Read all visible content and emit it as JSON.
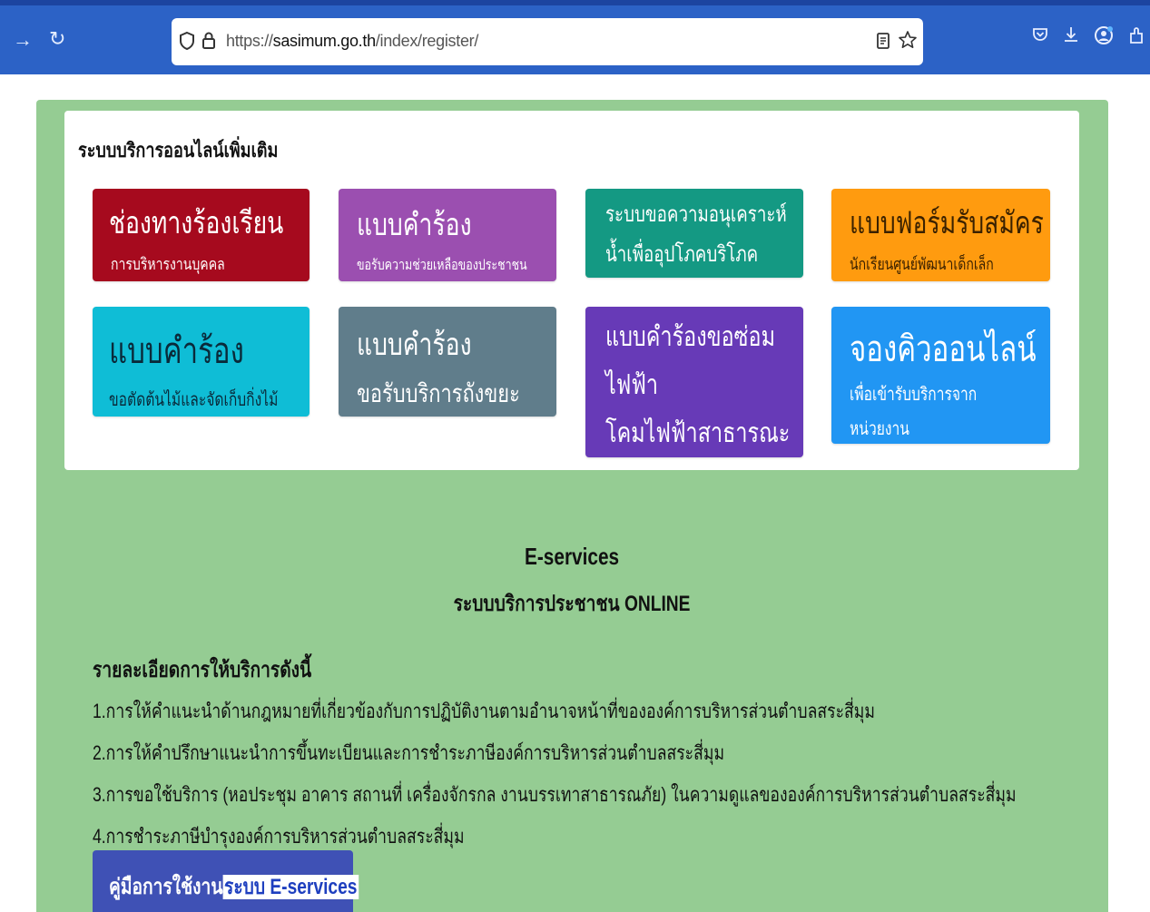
{
  "browser": {
    "url_prefix": "https://",
    "url_host": "sasimum.go.th",
    "url_path": "/index/register/",
    "icons": [
      "forward-icon",
      "reload-icon",
      "shield-icon",
      "lock-icon",
      "reader-mode-icon",
      "star-icon",
      "pocket-icon",
      "download-icon",
      "account-icon",
      "extensions-icon"
    ]
  },
  "card": {
    "title": "ระบบบริการออนไลน์เพิ่มเติม",
    "tiles": [
      {
        "main": "ช่องทางร้องเรียน",
        "sub": "การบริหารงานบุคคล",
        "color": "#a60a1e"
      },
      {
        "main": "แบบคำร้อง",
        "sub": "ขอรับความช่วยเหลือของประชาชน",
        "color": "#9b4fb0"
      },
      {
        "line1": "ระบบขอความอนุเคราะห์",
        "line2": "น้ำเพื่ออุปโภคบริโภค",
        "color": "#149983"
      },
      {
        "main": "แบบฟอร์มรับสมัคร",
        "sub": "นักเรียนศูนย์พัฒนาเด็กเล็ก",
        "color": "#ff9b0f"
      },
      {
        "main": "แบบคำร้อง",
        "sub": "ขอตัดต้นไม้และจัดเก็บกิ่งไม้",
        "color": "#0fbdd6"
      },
      {
        "line1": "แบบคำร้อง",
        "line2": "ขอรับบริการถังขยะ",
        "color": "#607d8b"
      },
      {
        "line1": "แบบคำร้องขอซ่อม",
        "line2": "ไฟฟ้า",
        "line3": "โคมไฟฟ้าสาธารณะ",
        "color": "#673ab7"
      },
      {
        "main": "จองคิวออนไลน์",
        "line1": "เพื่อเข้ารับบริการจาก",
        "line2": "หน่วยงาน",
        "color": "#2196f3"
      }
    ]
  },
  "eservices": {
    "title": "E-services",
    "subtitle": "ระบบบริการประชาชน ONLINE",
    "section_heading": "รายละเอียดการให้บริการดังนี้",
    "items": [
      "1.การให้คำแนะนำด้านกฎหมายที่เกี่ยวข้องกับการปฏิบัติงานตามอำนาจหน้าที่ขององค์การบริหารส่วนตำบลสระสี่มุม",
      "2.การให้คำปรึกษาแนะนำการขึ้นทะเบียนและการชำระภาษีองค์การบริหารส่วนตำบลสระสี่มุม",
      "3.การขอใช้บริการ (หอประชุม อาคาร สถานที่ เครื่องจักรกล งานบรรเทาสาธารณภัย) ในความดูแลขององค์การบริหารส่วนตำบลสระสี่มุม",
      "4.การชำระภาษีบำรุงองค์การบริหารส่วนตำบลสระสี่มุม"
    ],
    "guide_prefix": "คู่มือการใช้งาน",
    "guide_highlight": "ระบบ E-services"
  }
}
